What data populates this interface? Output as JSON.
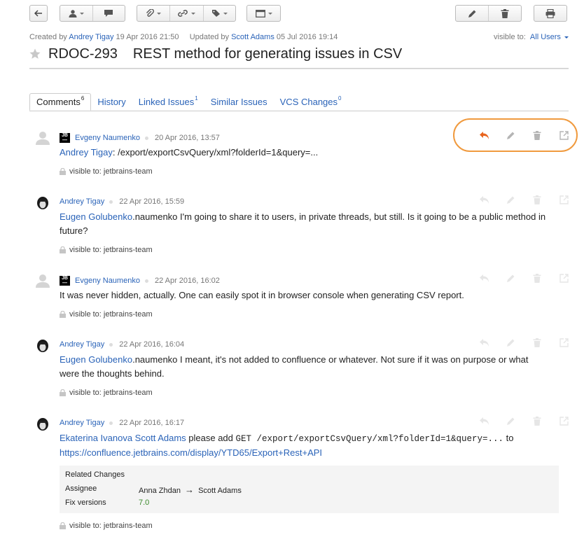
{
  "toolbar": {
    "icons": [
      "back-arrow-icon",
      "user-icon",
      "comment-icon",
      "attachment-icon",
      "link-icon",
      "tag-icon",
      "window-icon",
      "edit-icon",
      "trash-icon",
      "print-icon"
    ]
  },
  "issue": {
    "created_prefix": "Created by",
    "creator": "Andrey Tigay",
    "created_date": "19 Apr 2016 21:50",
    "updated_prefix": "Updated by",
    "updater": "Scott Adams",
    "updated_date": "05 Jul 2016 19:14",
    "visible_label": "visible to:",
    "visible_value": "All Users",
    "id": "RDOC-293",
    "summary": "REST method for generating issues in CSV"
  },
  "tabs": [
    {
      "label": "Comments",
      "count": "6"
    },
    {
      "label": "History",
      "count": ""
    },
    {
      "label": "Linked Issues",
      "count": "1"
    },
    {
      "label": "Similar Issues",
      "count": ""
    },
    {
      "label": "VCS Changes",
      "count": "0"
    }
  ],
  "comments": [
    {
      "author": "Evgeny Naumenko",
      "date": "20 Apr 2016, 13:57",
      "jb": true,
      "mention": "Andrey Tigay",
      "text": ": /export/exportCsvQuery/xml?folderId=1&query=...",
      "visibility": "visible to: jetbrains-team"
    },
    {
      "author": "Andrey Tigay",
      "date": "22 Apr 2016, 15:59",
      "jb": false,
      "mention": "Eugen Golubenko",
      "text": ".naumenko I'm going to share it to users, in private threads, but still. Is it going to be a public method in future?",
      "visibility": "visible to: jetbrains-team"
    },
    {
      "author": "Evgeny Naumenko",
      "date": "22 Apr 2016, 16:02",
      "jb": true,
      "mention": "",
      "text": "It was never hidden, actually. One can easily spot it in browser console when generating CSV report.",
      "visibility": "visible to: jetbrains-team"
    },
    {
      "author": "Andrey Tigay",
      "date": "22 Apr 2016, 16:04",
      "jb": false,
      "mention": "Eugen Golubenko",
      "text": ".naumenko I meant, it's not added to confluence or whatever. Not sure if it was on purpose or what were the thoughts behind.",
      "visibility": "visible to: jetbrains-team"
    },
    {
      "author": "Andrey Tigay",
      "date": "22 Apr 2016, 16:17",
      "jb": false,
      "mention": "Ekaterina Ivanova Scott Adams",
      "text": " please add ",
      "code": "GET /export/exportCsvQuery/xml?folderId=1&query=...",
      "text2": " to",
      "url": "https://confluence.jetbrains.com/display/YTD65/Export+Rest+API",
      "visibility": "visible to: jetbrains-team"
    }
  ],
  "related_changes": {
    "title": "Related Changes",
    "assignee_label": "Assignee",
    "assignee_from": "Anna Zhdan",
    "arrow": "→",
    "assignee_to": "Scott Adams",
    "fix_label": "Fix versions",
    "fix_value": "7.0"
  },
  "colors": {
    "accent": "#2a63b8",
    "reply_active": "#e8641e",
    "highlight": "#f09a3e",
    "fix_version": "#3a8a2b"
  }
}
